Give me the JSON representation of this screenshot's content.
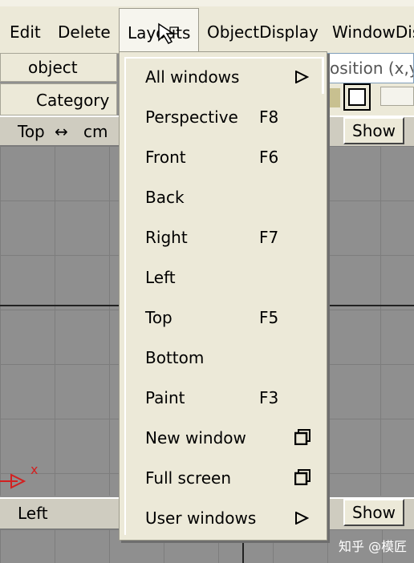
{
  "menubar": {
    "items": [
      "Edit",
      "Delete",
      "Layouts",
      "ObjectDisplay",
      "WindowDis"
    ]
  },
  "left_panel": {
    "object_label": "object",
    "category_label": "Category",
    "top_view": {
      "label": "Top",
      "unit": "cm"
    },
    "left_view": {
      "label": "Left"
    }
  },
  "right_panel": {
    "position_placeholder": "osition (x,y",
    "show_button": "Show",
    "show_button_bottom": "Show"
  },
  "layouts_menu": {
    "items": [
      {
        "label": "All windows",
        "shortcut": "",
        "has_submenu": true
      },
      {
        "label": "Perspective",
        "shortcut": "F8"
      },
      {
        "label": "Front",
        "shortcut": "F6"
      },
      {
        "label": "Back",
        "shortcut": ""
      },
      {
        "label": "Right",
        "shortcut": "F7"
      },
      {
        "label": "Left",
        "shortcut": ""
      },
      {
        "label": "Top",
        "shortcut": "F5"
      },
      {
        "label": "Bottom",
        "shortcut": ""
      },
      {
        "label": "Paint",
        "shortcut": "F3"
      },
      {
        "label": "New window",
        "shortcut": "",
        "icon": "window-icon"
      },
      {
        "label": "Full screen",
        "shortcut": "",
        "icon": "window-icon"
      },
      {
        "label": "User windows",
        "shortcut": "",
        "has_submenu": true
      }
    ]
  },
  "axis_label": "x",
  "watermark": "知乎 @模匠",
  "colors": {
    "menu_bg": "#ece9d8",
    "viewport_bg": "#8f8f8f",
    "axis_red": "#d22020"
  }
}
